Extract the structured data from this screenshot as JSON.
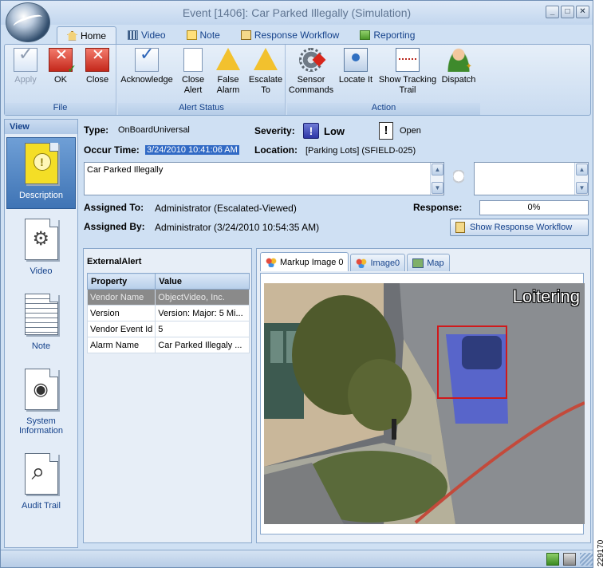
{
  "window": {
    "title": "Event [1406]: Car Parked Illegally (Simulation)",
    "controls": [
      "_",
      "□",
      "✕"
    ]
  },
  "tabs": [
    {
      "label": "Home",
      "icon": "home-icon"
    },
    {
      "label": "Video",
      "icon": "film-icon"
    },
    {
      "label": "Note",
      "icon": "note-icon"
    },
    {
      "label": "Response Workflow",
      "icon": "clipboard-icon"
    },
    {
      "label": "Reporting",
      "icon": "report-icon"
    }
  ],
  "ribbon": {
    "groups": {
      "file": "File",
      "alert_status": "Alert Status",
      "action": "Action"
    },
    "apply": "Apply",
    "ok": "OK",
    "close": "Close",
    "acknowledge": "Acknowledge",
    "close_alert": [
      "Close",
      "Alert"
    ],
    "false_alarm": [
      "False",
      "Alarm"
    ],
    "escalate_to": [
      "Escalate",
      "To"
    ],
    "sensor_commands": [
      "Sensor",
      "Commands"
    ],
    "locate_it": "Locate It",
    "show_tracking_trail": [
      "Show Tracking",
      "Trail"
    ],
    "dispatch": "Dispatch"
  },
  "leftnav": {
    "header": "View",
    "items": [
      {
        "label": "Description",
        "selected": true
      },
      {
        "label": "Video"
      },
      {
        "label": "Note"
      },
      {
        "label": "System Information",
        "lines": [
          "System",
          "Information"
        ]
      },
      {
        "label": "Audit Trail"
      }
    ]
  },
  "details": {
    "type_label": "Type:",
    "type_value": "OnBoardUniversal",
    "severity_label": "Severity:",
    "severity_value": "Low",
    "status_value": "Open",
    "occur_time_label": "Occur Time:",
    "occur_time_value": "3/24/2010 10:41:06 AM",
    "location_label": "Location:",
    "location_value": "[Parking Lots] (SFIELD-025)",
    "description_text": "Car Parked Illegally",
    "assigned_to_label": "Assigned To:",
    "assigned_to_value": "Administrator (Escalated-Viewed)",
    "assigned_by_label": "Assigned By:",
    "assigned_by_value": "Administrator (3/24/2010 10:54:35 AM)",
    "response_label": "Response:",
    "response_value": "0%",
    "show_response_workflow": "Show Response Workflow"
  },
  "external_alert": {
    "title": "ExternalAlert",
    "columns": [
      "Property",
      "Value"
    ],
    "rows": [
      [
        "Vendor Name",
        "ObjectVideo, Inc."
      ],
      [
        "Version",
        "Version: Major: 5 Mi..."
      ],
      [
        "Vendor Event Id",
        "5"
      ],
      [
        "Alarm Name",
        "Car Parked Illegaly ..."
      ]
    ]
  },
  "image_tabs": [
    {
      "label": "Markup Image 0",
      "active": true
    },
    {
      "label": "Image0"
    },
    {
      "label": "Map"
    }
  ],
  "image": {
    "overlay_text": "Loitering"
  },
  "side_caption": "229170",
  "colors": {
    "accent": "#15428b",
    "selection": "#316ac5",
    "alert_box": "#d0191b",
    "track_fill": "#4b5bd8"
  }
}
